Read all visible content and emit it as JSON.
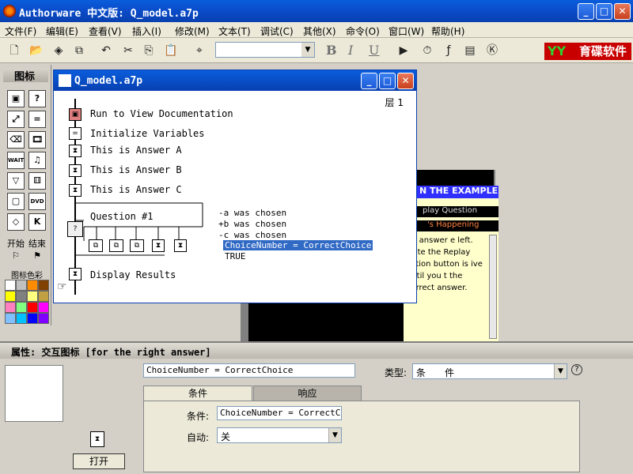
{
  "app": {
    "title": "Authorware 中文版: Q_model.a7p"
  },
  "window_controls": {
    "minimize": "_",
    "maximize": "□",
    "close": "✕"
  },
  "menubar": {
    "items": [
      "文件(F)",
      "编辑(E)",
      "查看(V)",
      "插入(I)",
      "修改(M)",
      "文本(T)",
      "调试(C)",
      "其他(X)",
      "命令(O)",
      "窗口(W)",
      "帮助(H)"
    ]
  },
  "toolbar": {
    "icons": [
      "new-icon",
      "open-icon",
      "save-all-icon",
      "import-icon",
      "undo-icon",
      "cut-icon",
      "copy-icon",
      "paste-icon",
      "find-icon"
    ],
    "font_combo_value": "",
    "bold": "B",
    "italic": "I",
    "underline": "U",
    "run_icons": [
      "play-icon",
      "restart-icon",
      "functions-icon",
      "variables-icon",
      "ko-icon"
    ]
  },
  "brand": {
    "logo": "YY",
    "text": "育碟软件"
  },
  "palette": {
    "title": "图标",
    "start_label": "开始",
    "end_label": "结束",
    "color_label": "图标色彩",
    "swatches": [
      "#ffffff",
      "#c0c0c0",
      "#ff8c00",
      "#804000",
      "#ffff00",
      "#808080",
      "#ffff80",
      "#c0a040",
      "#ff80c0",
      "#80ff80",
      "#ff0000",
      "#ff00ff",
      "#80c0ff",
      "#00c0ff",
      "#0000ff",
      "#8000ff"
    ]
  },
  "flow_window": {
    "title": "Q_model.a7p",
    "layer": "层 1",
    "nodes": [
      {
        "label": "Run to View Documentation"
      },
      {
        "label": "Initialize Variables"
      },
      {
        "label": "This is Answer A"
      },
      {
        "label": "This is Answer B"
      },
      {
        "label": "This is Answer C"
      },
      {
        "label": "Question #1"
      },
      {
        "label": "Display Results"
      }
    ],
    "responses": [
      "-a was chosen",
      "+b was chosen",
      "-c was chosen",
      "ChoiceNumber = CorrectChoice",
      "TRUE"
    ]
  },
  "bg_window": {
    "header": "N THE EXAMPLE",
    "button": "play Question",
    "status": "'s Happening",
    "text": "an answer e left. Note the Replay estion button is ive until you t the correct answer."
  },
  "properties": {
    "title": "属性: 交互图标 [for the right answer]",
    "name_value": "ChoiceNumber = CorrectChoice",
    "type_label": "类型:",
    "type_value": "条　　件",
    "help": "?",
    "open_button": "打开",
    "tabs": [
      "条件",
      "响应"
    ],
    "condition_label": "条件:",
    "condition_value": "ChoiceNumber = CorrectChoi",
    "auto_label": "自动:",
    "auto_value": "关"
  }
}
